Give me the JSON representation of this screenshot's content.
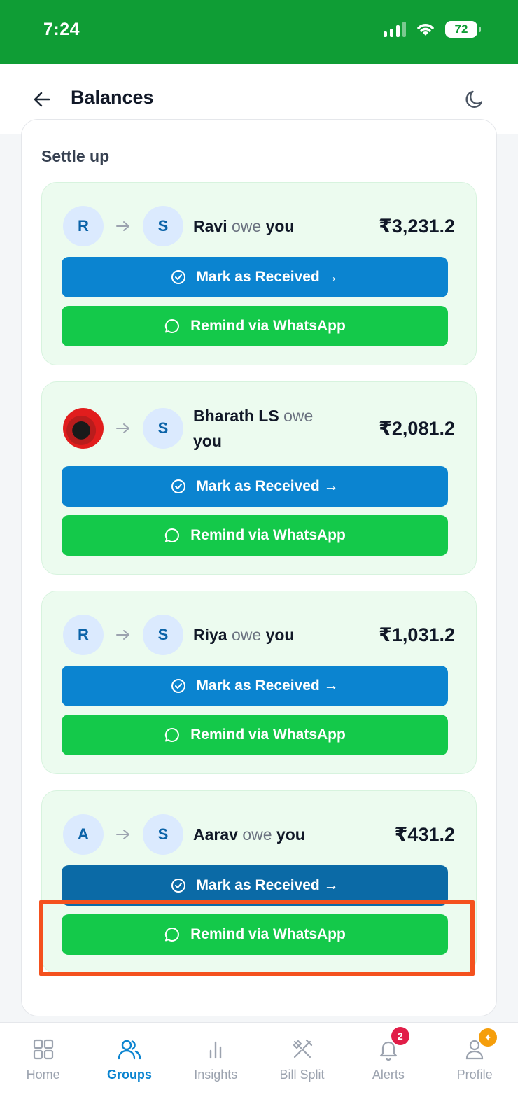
{
  "status": {
    "time": "7:24",
    "battery": "72"
  },
  "header": {
    "title": "Balances"
  },
  "section": {
    "title": "Settle up"
  },
  "cards": [
    {
      "from_initial": "R",
      "to_initial": "S",
      "name": "Ravi",
      "verb": "owe",
      "object": "you",
      "amount": "₹3,231.2",
      "mark_label": "Mark as Received →",
      "remind_label": "Remind via WhatsApp"
    },
    {
      "from_initial": "",
      "to_initial": "S",
      "name": "Bharath LS",
      "verb": "owe",
      "object": "you",
      "amount": "₹2,081.2",
      "mark_label": "Mark as Received →",
      "remind_label": "Remind via WhatsApp"
    },
    {
      "from_initial": "R",
      "to_initial": "S",
      "name": "Riya",
      "verb": "owe",
      "object": "you",
      "amount": "₹1,031.2",
      "mark_label": "Mark as Received →",
      "remind_label": "Remind via WhatsApp"
    },
    {
      "from_initial": "A",
      "to_initial": "S",
      "name": "Aarav",
      "verb": "owe",
      "object": "you",
      "amount": "₹431.2",
      "mark_label": "Mark as Received →",
      "remind_label": "Remind via WhatsApp"
    }
  ],
  "nav": [
    {
      "label": "Home",
      "icon": "home-grid-icon"
    },
    {
      "label": "Groups",
      "icon": "groups-icon"
    },
    {
      "label": "Insights",
      "icon": "insights-bars-icon"
    },
    {
      "label": "Bill Split",
      "icon": "utensils-icon"
    },
    {
      "label": "Alerts",
      "icon": "bell-icon",
      "badge": "2"
    },
    {
      "label": "Profile",
      "icon": "profile-icon"
    }
  ],
  "colors": {
    "status_bar": "#0f9d35",
    "primary_blue": "#0b84d0",
    "whatsapp_green": "#14c94a",
    "card_bg": "#ecfbef",
    "highlight": "#f4511e"
  }
}
